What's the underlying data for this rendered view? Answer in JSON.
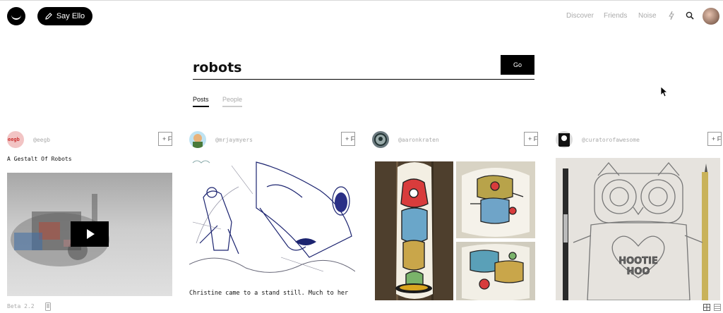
{
  "header": {
    "say_ello_label": "Say Ello",
    "nav": [
      {
        "label": "Discover"
      },
      {
        "label": "Friends"
      },
      {
        "label": "Noise"
      }
    ],
    "icons": [
      "lightning-icon",
      "search-icon"
    ]
  },
  "search": {
    "query": "robots",
    "go_label": "Go",
    "tabs": [
      {
        "label": "Posts",
        "active": true
      },
      {
        "label": "People",
        "active": false
      }
    ]
  },
  "posts": [
    {
      "handle": "@eegb",
      "avatar_label": "eegb",
      "title": "A Gestalt Of Robots",
      "follow_label": "+ F"
    },
    {
      "handle": "@mrjaymyers",
      "caption": "Christine came to a stand still. Much to her",
      "follow_label": "+ F"
    },
    {
      "handle": "@aaronkraten",
      "follow_label": "+ F"
    },
    {
      "handle": "@curatorofawesome",
      "follow_label": "+ F",
      "image_text": [
        "HOOTIE",
        "HOO"
      ]
    }
  ],
  "footer": {
    "version": "Beta 2.2"
  },
  "colors": {
    "accent": "#000000",
    "muted": "#aaaaaa"
  }
}
